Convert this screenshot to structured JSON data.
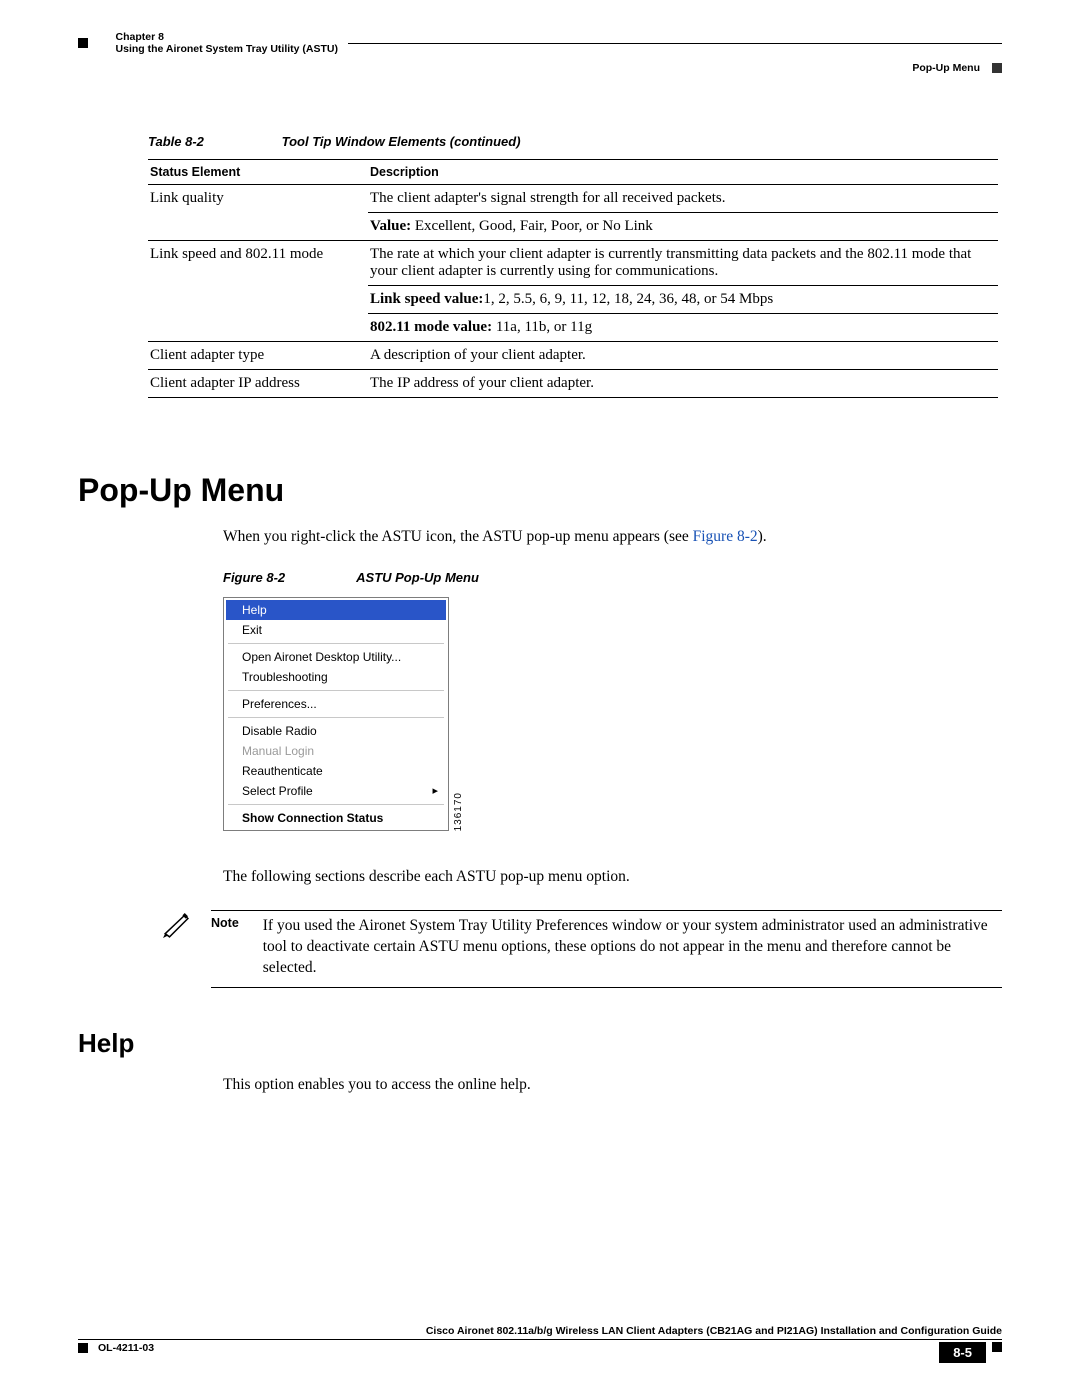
{
  "header": {
    "chapter_label": "Chapter 8",
    "chapter_title": "Using the Aironet System Tray Utility (ASTU)",
    "breadcrumb": "Pop-Up Menu"
  },
  "table": {
    "caption_label": "Table 8-2",
    "caption_title": "Tool Tip Window Elements (continued)",
    "th1": "Status Element",
    "th2": "Description",
    "rows": {
      "r1c1": "Link quality",
      "r1c2a": "The client adapter's signal strength for all received packets.",
      "r1c2b_lbl": "Value:",
      "r1c2b_val": "   Excellent, Good, Fair, Poor, or No Link",
      "r2c1": "Link speed and 802.11 mode",
      "r2c2a": "The rate at which your client adapter is currently transmitting data packets and the 802.11 mode that your client adapter is currently using for communications.",
      "r2c2b_lbl": "Link speed value:",
      "r2c2b_val": "1, 2, 5.5, 6, 9, 11, 12, 18, 24, 36, 48, or 54 Mbps",
      "r2c2c_lbl": "802.11 mode value:",
      "r2c2c_val": " 11a, 11b, or 11g",
      "r3c1": "Client adapter type",
      "r3c2": "A description of your client adapter.",
      "r4c1": "Client adapter IP address",
      "r4c2": "The IP address of your client adapter."
    }
  },
  "section": {
    "h1": "Pop-Up Menu",
    "intro_pre": "When you right-click the ASTU icon, the ASTU pop-up menu appears (see ",
    "intro_link": "Figure 8-2",
    "intro_post": ").",
    "fig_label": "Figure 8-2",
    "fig_title": "ASTU Pop-Up Menu",
    "fig_id": "136170",
    "after_fig": "The following sections describe each ASTU pop-up menu option.",
    "note_lead": "Note",
    "note_text": "If you used the Aironet System Tray Utility Preferences window or your system administrator used an administrative tool to deactivate certain ASTU menu options, these options do not appear in the menu and therefore cannot be selected.",
    "h2": "Help",
    "help_text": "This option enables you to access the online help."
  },
  "menu": {
    "items": {
      "help": "Help",
      "exit": "Exit",
      "open": "Open Aironet Desktop Utility...",
      "trouble": "Troubleshooting",
      "prefs": "Preferences...",
      "disable": "Disable Radio",
      "manual": "Manual Login",
      "reauth": "Reauthenticate",
      "select": "Select Profile",
      "show": "Show Connection Status"
    }
  },
  "footer": {
    "guide": "Cisco Aironet 802.11a/b/g Wireless LAN Client Adapters (CB21AG and PI21AG) Installation and Configuration Guide",
    "docnum": "OL-4211-03",
    "page": "8-5"
  }
}
